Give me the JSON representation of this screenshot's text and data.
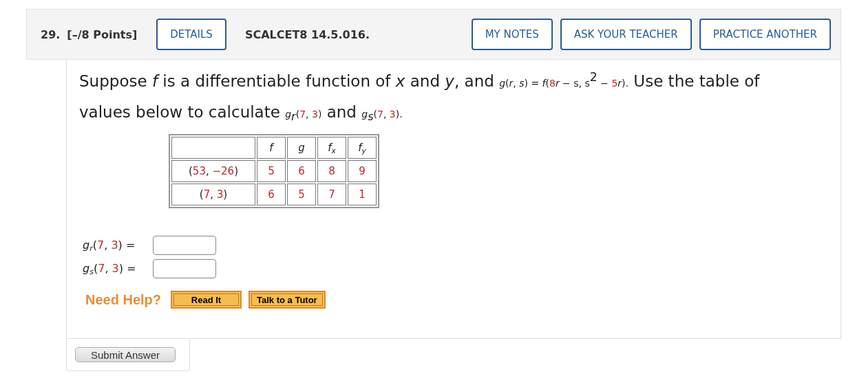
{
  "header": {
    "number": "29.",
    "points": "[–/8 Points]",
    "details_button": "DETAILS",
    "problem_id": "SCALCET8 14.5.016.",
    "actions": [
      "MY NOTES",
      "ASK YOUR TEACHER",
      "PRACTICE ANOTHER"
    ]
  },
  "question": [
    {
      "kind": "plain",
      "text": "Suppose "
    },
    {
      "kind": "variable",
      "text": "f"
    },
    {
      "kind": "plain",
      "text": " is a differentiable function of "
    },
    {
      "kind": "variable",
      "text": "x"
    },
    {
      "kind": "plain",
      "text": " and "
    },
    {
      "kind": "variable",
      "text": "y"
    },
    {
      "kind": "plain",
      "text": ", and "
    },
    {
      "kind": "formula_variable",
      "text": "g"
    },
    {
      "kind": "formula",
      "text": "("
    },
    {
      "kind": "formula_variable",
      "text": "r"
    },
    {
      "kind": "formula",
      "text": ", "
    },
    {
      "kind": "formula_variable",
      "text": "s"
    },
    {
      "kind": "formula",
      "text": ") = "
    },
    {
      "kind": "formula_variable",
      "text": "f"
    },
    {
      "kind": "formula",
      "text": "("
    },
    {
      "kind": "formula_number",
      "text": "8"
    },
    {
      "kind": "formula_variable",
      "text": "r"
    },
    {
      "kind": "formula",
      "text": " − s, s"
    },
    {
      "kind": "formula_superscript",
      "text": "2"
    },
    {
      "kind": "formula",
      "text": " − "
    },
    {
      "kind": "formula_number",
      "text": "5"
    },
    {
      "kind": "formula_variable",
      "text": "r"
    },
    {
      "kind": "formula",
      "text": ")."
    },
    {
      "kind": "plain",
      "text": " Use the table of values below to calculate "
    },
    {
      "kind": "formula_variable",
      "text": "g"
    },
    {
      "kind": "formula_subscript",
      "text": "r"
    },
    {
      "kind": "formula",
      "text": "("
    },
    {
      "kind": "formula_number",
      "text": "7"
    },
    {
      "kind": "formula",
      "text": ", "
    },
    {
      "kind": "formula_number",
      "text": "3"
    },
    {
      "kind": "formula",
      "text": ")"
    },
    {
      "kind": "plain",
      "text": " and "
    },
    {
      "kind": "formula_variable",
      "text": "g"
    },
    {
      "kind": "formula_subscript",
      "text": "s"
    },
    {
      "kind": "formula",
      "text": "("
    },
    {
      "kind": "formula_number",
      "text": "7"
    },
    {
      "kind": "formula",
      "text": ", "
    },
    {
      "kind": "formula_number",
      "text": "3"
    },
    {
      "kind": "formula",
      "text": ")."
    }
  ],
  "table": {
    "columns": [
      [
        {
          "kind": "variable",
          "text": "f"
        }
      ],
      [
        {
          "kind": "variable",
          "text": "g"
        }
      ],
      [
        {
          "kind": "variable",
          "text": "f"
        },
        {
          "kind": "subscript",
          "text": "x"
        }
      ],
      [
        {
          "kind": "variable",
          "text": "f"
        },
        {
          "kind": "subscript",
          "text": "y"
        }
      ]
    ],
    "rows": [
      {
        "point": [
          {
            "kind": "plain",
            "text": "("
          },
          {
            "kind": "number",
            "text": "53"
          },
          {
            "kind": "plain",
            "text": ", "
          },
          {
            "kind": "number",
            "text": "−26"
          },
          {
            "kind": "plain",
            "text": ")"
          }
        ],
        "values": [
          "5",
          "6",
          "8",
          "9"
        ]
      },
      {
        "point": [
          {
            "kind": "plain",
            "text": "("
          },
          {
            "kind": "number",
            "text": "7"
          },
          {
            "kind": "plain",
            "text": ", "
          },
          {
            "kind": "number",
            "text": "3"
          },
          {
            "kind": "plain",
            "text": ")"
          }
        ],
        "values": [
          "6",
          "5",
          "7",
          "1"
        ]
      }
    ]
  },
  "answers": [
    {
      "label": [
        {
          "kind": "variable",
          "text": "g"
        },
        {
          "kind": "subscript",
          "text": "r"
        },
        {
          "kind": "plain",
          "text": "("
        },
        {
          "kind": "number",
          "text": "7"
        },
        {
          "kind": "plain",
          "text": ", "
        },
        {
          "kind": "number",
          "text": "3"
        },
        {
          "kind": "plain",
          "text": ") ="
        }
      ]
    },
    {
      "label": [
        {
          "kind": "variable",
          "text": "g"
        },
        {
          "kind": "subscript",
          "text": "s"
        },
        {
          "kind": "plain",
          "text": "("
        },
        {
          "kind": "number",
          "text": "7"
        },
        {
          "kind": "plain",
          "text": ", "
        },
        {
          "kind": "number",
          "text": "3"
        },
        {
          "kind": "plain",
          "text": ") ="
        }
      ]
    }
  ],
  "help": {
    "label": "Need Help?",
    "buttons": [
      "Read It",
      "Talk to a Tutor"
    ]
  },
  "submit": "Submit Answer"
}
